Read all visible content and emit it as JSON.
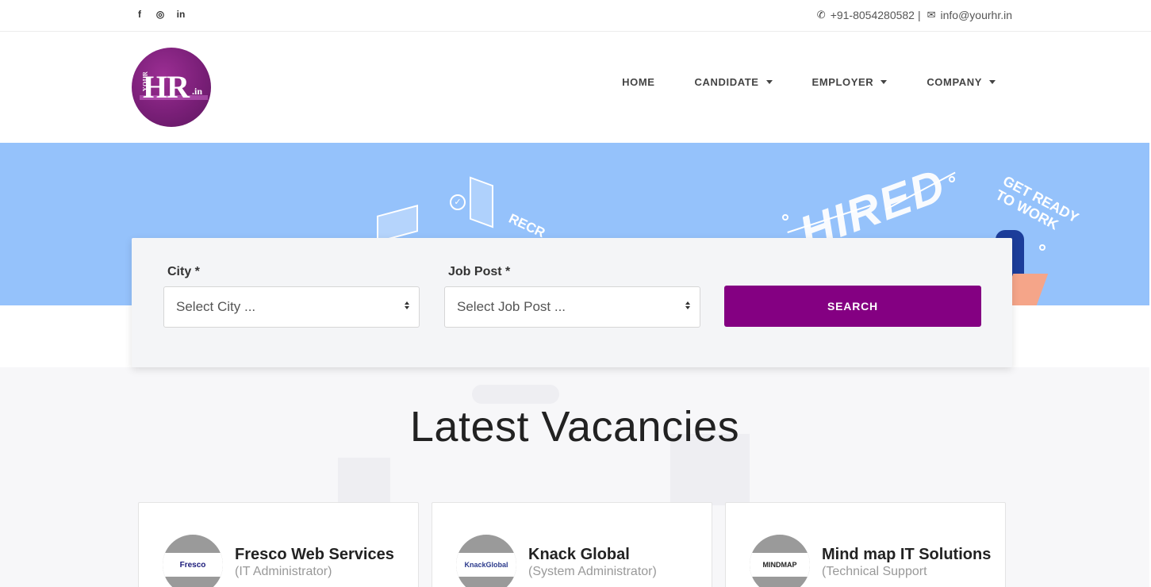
{
  "topbar": {
    "social": [
      "f",
      "◎",
      "in"
    ],
    "phone": "+91-8054280582",
    "separator": "|",
    "email": "info@yourhr.in"
  },
  "logo": {
    "small": "YOUR",
    "main": "HR",
    "suffix": ".in"
  },
  "nav": {
    "items": [
      {
        "label": "HOME",
        "dropdown": false
      },
      {
        "label": "CANDIDATE",
        "dropdown": true
      },
      {
        "label": "EMPLOYER",
        "dropdown": true
      },
      {
        "label": "COMPANY",
        "dropdown": true
      }
    ]
  },
  "banner": {
    "hired": "HIRED",
    "get_ready_1": "GET READY",
    "get_ready_2": "TO WORK",
    "recr": "RECR"
  },
  "search": {
    "city_label": "City *",
    "city_value": "Select City ...",
    "job_label": "Job Post *",
    "job_value": "Select Job Post ...",
    "button": "SEARCH"
  },
  "vacancies": {
    "title": "Latest Vacancies",
    "jobs": [
      {
        "company": "Fresco Web Services",
        "post": "(IT Administrator)",
        "logo_text": "Fresco"
      },
      {
        "company": "Knack Global",
        "post": "(System Administrator)",
        "logo_text": "KnackGlobal"
      },
      {
        "company": "Mind map IT Solutions",
        "post": "(Technical Support",
        "logo_text": "MINDMAP"
      }
    ]
  },
  "colors": {
    "accent": "#840082",
    "banner": "#95c2fb"
  }
}
